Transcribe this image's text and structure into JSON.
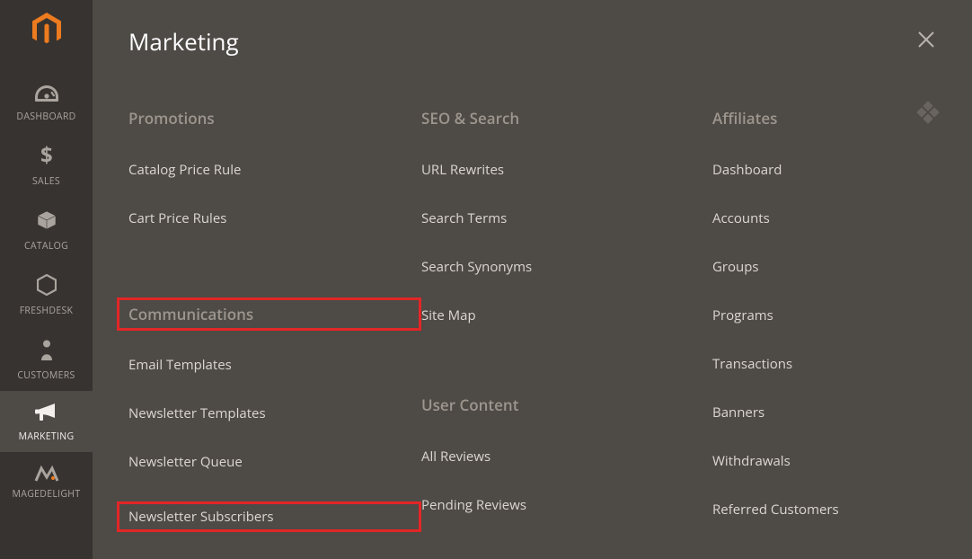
{
  "sidebar": {
    "items": [
      {
        "label": "DASHBOARD"
      },
      {
        "label": "SALES"
      },
      {
        "label": "CATALOG"
      },
      {
        "label": "FRESHDESK"
      },
      {
        "label": "CUSTOMERS"
      },
      {
        "label": "MARKETING"
      },
      {
        "label": "MAGEDELIGHT"
      }
    ]
  },
  "panel": {
    "title": "Marketing",
    "columns": [
      {
        "sections": [
          {
            "heading": "Promotions",
            "items": [
              "Catalog Price Rule",
              "Cart Price Rules"
            ]
          },
          {
            "heading": "Communications",
            "heading_highlight": true,
            "items": [
              "Email Templates",
              "Newsletter Templates",
              "Newsletter Queue",
              "Newsletter Subscribers"
            ],
            "highlight_item_index": 3
          }
        ]
      },
      {
        "sections": [
          {
            "heading": "SEO & Search",
            "items": [
              "URL Rewrites",
              "Search Terms",
              "Search Synonyms",
              "Site Map"
            ]
          },
          {
            "heading": "User Content",
            "items": [
              "All Reviews",
              "Pending Reviews"
            ]
          }
        ]
      },
      {
        "sections": [
          {
            "heading": "Affiliates",
            "items": [
              "Dashboard",
              "Accounts",
              "Groups",
              "Programs",
              "Transactions",
              "Banners",
              "Withdrawals",
              "Referred Customers"
            ]
          }
        ]
      }
    ]
  }
}
